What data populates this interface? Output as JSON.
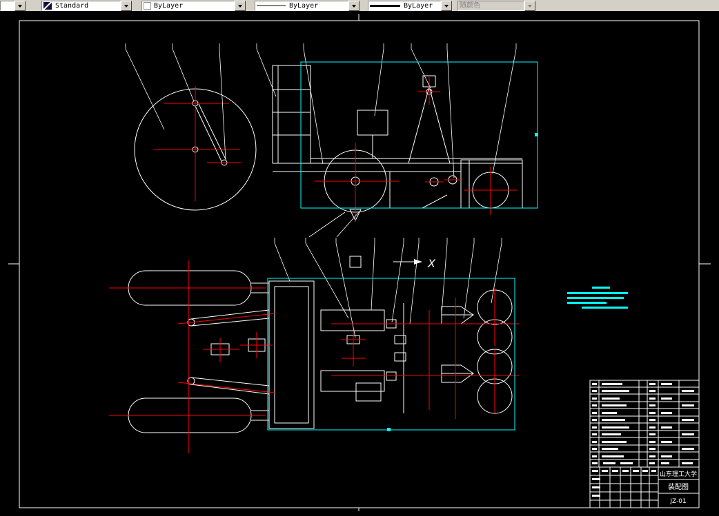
{
  "toolbar": {
    "left_combo": {
      "value": ""
    },
    "style_combo": {
      "value": "Standard"
    },
    "color_combo": {
      "value": "ByLayer"
    },
    "linetype_combo": {
      "value": "ByLayer"
    },
    "lineweight_combo": {
      "value": "ByLayer"
    },
    "plotstyle_combo": {
      "value": "随颜色"
    }
  },
  "drawing": {
    "axis_label": "X"
  },
  "title_block": {
    "organization": "山东理工大学",
    "drawing_title": "装配图",
    "drawing_number": "JZ-01"
  },
  "colors": {
    "canvas_bg": "#000000",
    "geometry": "#ffffff",
    "centerline": "#ff0000",
    "selection_highlight": "#00ffff",
    "toolbar_bg": "#d4d0c8"
  }
}
